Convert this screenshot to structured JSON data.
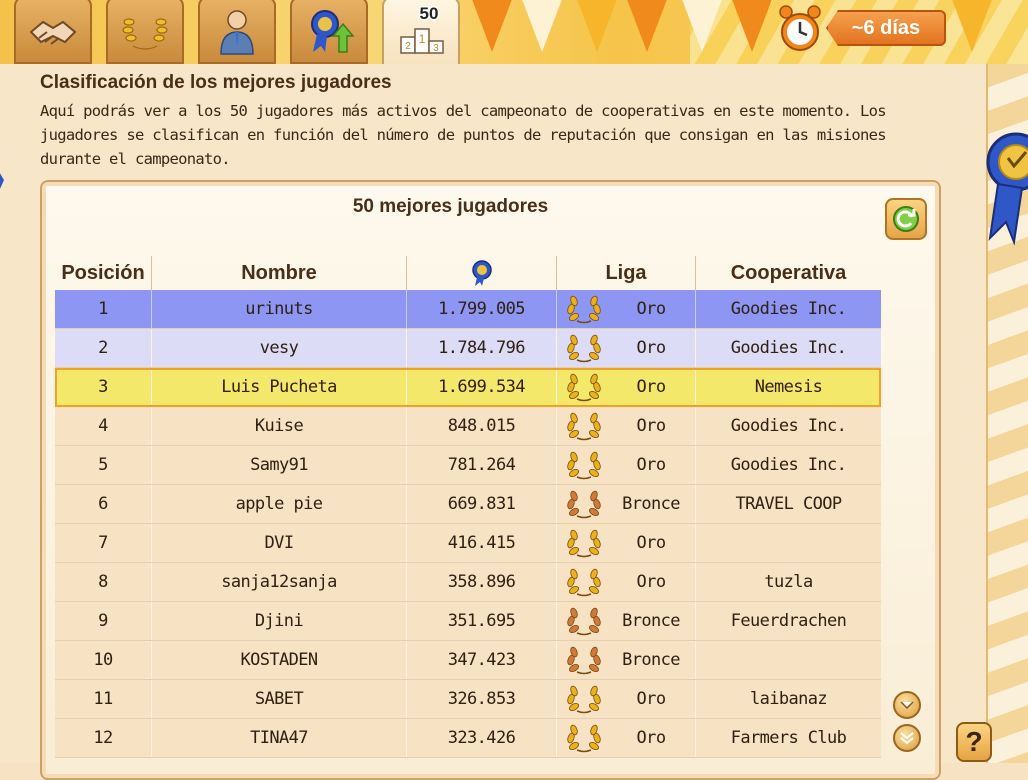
{
  "tabs": [
    {
      "icon": "handshake-icon"
    },
    {
      "icon": "laurel-icon"
    },
    {
      "icon": "businessman-icon"
    },
    {
      "icon": "rosette-upgrade-icon"
    },
    {
      "icon": "podium-icon",
      "badge": "50",
      "podium": [
        "2",
        "1",
        "3"
      ]
    }
  ],
  "timer": {
    "label": "~6 días"
  },
  "header": {
    "title": "Clasificación de los mejores jugadores",
    "description": "Aquí podrás ver a los 50 jugadores más activos del campeonato de cooperativas en este momento. Los jugadores se clasifican en función del número de puntos de reputación que consigan en las misiones durante el campeonato."
  },
  "leaderboard": {
    "title": "50 mejores jugadores",
    "columns": {
      "position": "Posición",
      "name": "Nombre",
      "reputation_icon": "rosette-icon",
      "league": "Liga",
      "coop": "Cooperativa"
    },
    "rows": [
      {
        "pos": "1",
        "name": "urinuts",
        "points": "1.799.005",
        "league": "Oro",
        "coop": "Goodies Inc."
      },
      {
        "pos": "2",
        "name": "vesy",
        "points": "1.784.796",
        "league": "Oro",
        "coop": "Goodies Inc."
      },
      {
        "pos": "3",
        "name": "Luis Pucheta",
        "points": "1.699.534",
        "league": "Oro",
        "coop": "Nemesis"
      },
      {
        "pos": "4",
        "name": "Kuise",
        "points": "848.015",
        "league": "Oro",
        "coop": "Goodies Inc."
      },
      {
        "pos": "5",
        "name": "Samy91",
        "points": "781.264",
        "league": "Oro",
        "coop": "Goodies Inc."
      },
      {
        "pos": "6",
        "name": "apple pie",
        "points": "669.831",
        "league": "Bronce",
        "coop": "TRAVEL COOP"
      },
      {
        "pos": "7",
        "name": "DVI",
        "points": "416.415",
        "league": "Oro",
        "coop": ""
      },
      {
        "pos": "8",
        "name": "sanja12sanja",
        "points": "358.896",
        "league": "Oro",
        "coop": "tuzla"
      },
      {
        "pos": "9",
        "name": "Djini",
        "points": "351.695",
        "league": "Bronce",
        "coop": "Feuerdrachen"
      },
      {
        "pos": "10",
        "name": "KOSTADEN",
        "points": "347.423",
        "league": "Bronce",
        "coop": ""
      },
      {
        "pos": "11",
        "name": "SABET",
        "points": "326.853",
        "league": "Oro",
        "coop": "laibanaz"
      },
      {
        "pos": "12",
        "name": "TINA47",
        "points": "323.426",
        "league": "Oro",
        "coop": "Farmers Club"
      }
    ]
  },
  "colors": {
    "gold_laurel": "#e9b21c",
    "bronze_laurel": "#d07a3a",
    "row_first": "#8d96f2",
    "row_second": "#dcdcf6",
    "row_highlight": "#f3e86a",
    "row_default": "#f8e2c4"
  },
  "help": {
    "label": "?"
  }
}
